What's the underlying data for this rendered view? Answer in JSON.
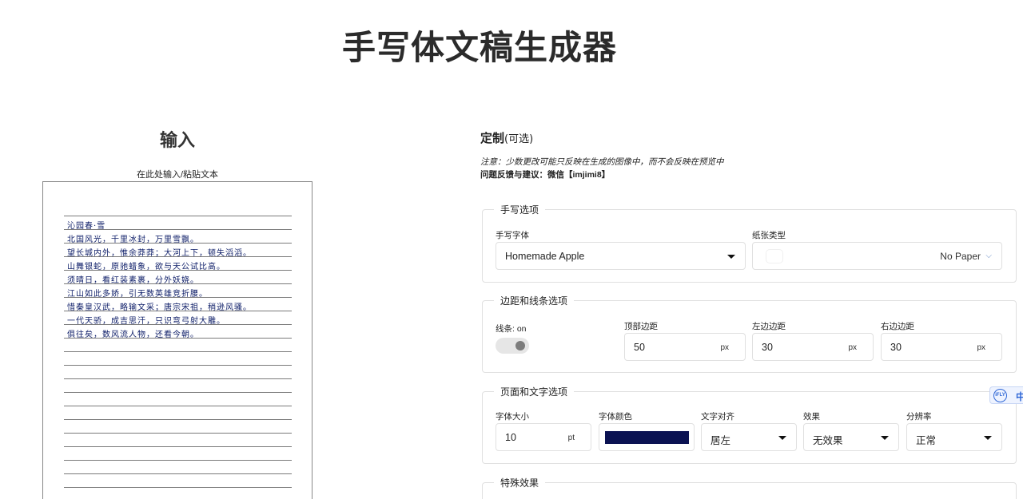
{
  "page": {
    "title": "手写体文稿生成器"
  },
  "input": {
    "title": "输入",
    "label": "在此处输入/粘贴文本",
    "lines": [
      "沁园春·雪",
      "北国风光，千里冰封，万里雪飘。",
      "望长城内外，惟余莽莽；大河上下，顿失滔滔。",
      "山舞银蛇，原驰蜡象，欲与天公试比高。",
      "须晴日，看红装素裹，分外妖娆。",
      "江山如此多娇，引无数英雄竞折腰。",
      "惜秦皇汉武，略输文采；唐宗宋祖，稍逊风骚。",
      "一代天骄，成吉思汗，只识弯弓射大雕。",
      "俱往矣，数风流人物，还看今朝。"
    ]
  },
  "custom": {
    "heading": "定制",
    "heading_optional": "(可选)",
    "note": "注意：少数更改可能只反映在生成的图像中，而不会反映在预览中",
    "feedback": "问题反馈与建议：微信【imjimi8】"
  },
  "handwriting": {
    "legend": "手写选项",
    "font_label": "手写字体",
    "font_value": "Homemade Apple",
    "paper_label": "纸张类型",
    "paper_value": "No Paper"
  },
  "margins": {
    "legend": "边距和线条选项",
    "lines_label": "线条: on",
    "top_label": "顶部边距",
    "top_value": "50",
    "left_label": "左边边距",
    "left_value": "30",
    "right_label": "右边边距",
    "right_value": "30",
    "unit": "px"
  },
  "text_options": {
    "legend": "页面和文字选项",
    "size_label": "字体大小",
    "size_value": "10",
    "size_unit": "pt",
    "color_label": "字体颜色",
    "color_value": "#0b1252",
    "align_label": "文字对齐",
    "align_value": "居左",
    "effect_label": "效果",
    "effect_value": "无效果",
    "resolution_label": "分辨率",
    "resolution_value": "正常"
  },
  "special": {
    "legend": "特殊效果"
  },
  "widget": {
    "logo": "iFLY",
    "lang": "中"
  }
}
